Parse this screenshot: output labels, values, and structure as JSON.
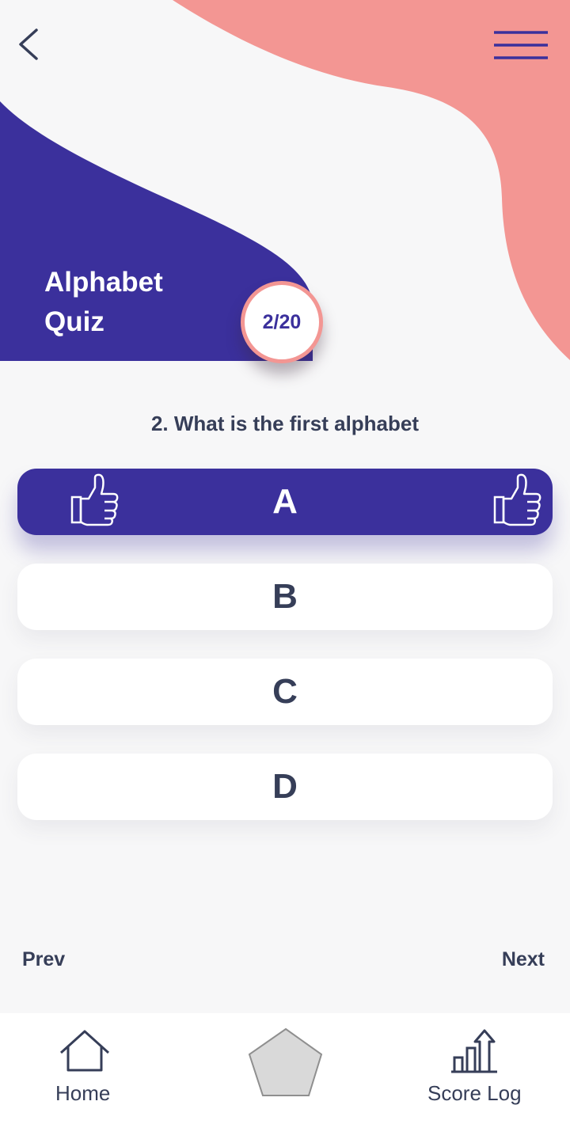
{
  "colors": {
    "background": "#f7f7f8",
    "primary_purple": "#3b309c",
    "accent_coral": "#f39693",
    "text_dark": "#363e58",
    "white": "#ffffff"
  },
  "header": {
    "back_icon": "chevron-left-icon",
    "menu_icon": "hamburger-menu-icon"
  },
  "quiz": {
    "title": "Alphabet\nQuiz",
    "progress": "2/20",
    "question": "2. What is the first alphabet",
    "options": [
      {
        "label": "A",
        "selected": true,
        "icon": "thumbs-up-icon"
      },
      {
        "label": "B",
        "selected": false
      },
      {
        "label": "C",
        "selected": false
      },
      {
        "label": "D",
        "selected": false
      }
    ]
  },
  "navigation": {
    "prev_label": "Prev",
    "next_label": "Next"
  },
  "bottom_nav": {
    "home_label": "Home",
    "home_icon": "home-icon",
    "center_icon": "pentagon-icon",
    "score_label": "Score Log",
    "score_icon": "bar-chart-up-icon"
  }
}
